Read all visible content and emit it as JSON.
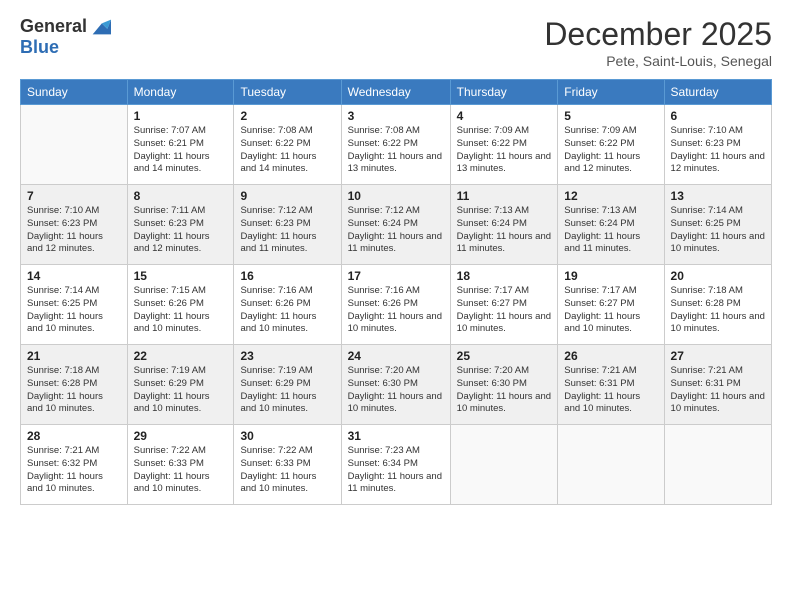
{
  "header": {
    "logo_general": "General",
    "logo_blue": "Blue",
    "month_title": "December 2025",
    "location": "Pete, Saint-Louis, Senegal"
  },
  "weekdays": [
    "Sunday",
    "Monday",
    "Tuesday",
    "Wednesday",
    "Thursday",
    "Friday",
    "Saturday"
  ],
  "weeks": [
    [
      {
        "day": "",
        "sunrise": "",
        "sunset": "",
        "daylight": ""
      },
      {
        "day": "1",
        "sunrise": "Sunrise: 7:07 AM",
        "sunset": "Sunset: 6:21 PM",
        "daylight": "Daylight: 11 hours and 14 minutes."
      },
      {
        "day": "2",
        "sunrise": "Sunrise: 7:08 AM",
        "sunset": "Sunset: 6:22 PM",
        "daylight": "Daylight: 11 hours and 14 minutes."
      },
      {
        "day": "3",
        "sunrise": "Sunrise: 7:08 AM",
        "sunset": "Sunset: 6:22 PM",
        "daylight": "Daylight: 11 hours and 13 minutes."
      },
      {
        "day": "4",
        "sunrise": "Sunrise: 7:09 AM",
        "sunset": "Sunset: 6:22 PM",
        "daylight": "Daylight: 11 hours and 13 minutes."
      },
      {
        "day": "5",
        "sunrise": "Sunrise: 7:09 AM",
        "sunset": "Sunset: 6:22 PM",
        "daylight": "Daylight: 11 hours and 12 minutes."
      },
      {
        "day": "6",
        "sunrise": "Sunrise: 7:10 AM",
        "sunset": "Sunset: 6:23 PM",
        "daylight": "Daylight: 11 hours and 12 minutes."
      }
    ],
    [
      {
        "day": "7",
        "sunrise": "Sunrise: 7:10 AM",
        "sunset": "Sunset: 6:23 PM",
        "daylight": "Daylight: 11 hours and 12 minutes."
      },
      {
        "day": "8",
        "sunrise": "Sunrise: 7:11 AM",
        "sunset": "Sunset: 6:23 PM",
        "daylight": "Daylight: 11 hours and 12 minutes."
      },
      {
        "day": "9",
        "sunrise": "Sunrise: 7:12 AM",
        "sunset": "Sunset: 6:23 PM",
        "daylight": "Daylight: 11 hours and 11 minutes."
      },
      {
        "day": "10",
        "sunrise": "Sunrise: 7:12 AM",
        "sunset": "Sunset: 6:24 PM",
        "daylight": "Daylight: 11 hours and 11 minutes."
      },
      {
        "day": "11",
        "sunrise": "Sunrise: 7:13 AM",
        "sunset": "Sunset: 6:24 PM",
        "daylight": "Daylight: 11 hours and 11 minutes."
      },
      {
        "day": "12",
        "sunrise": "Sunrise: 7:13 AM",
        "sunset": "Sunset: 6:24 PM",
        "daylight": "Daylight: 11 hours and 11 minutes."
      },
      {
        "day": "13",
        "sunrise": "Sunrise: 7:14 AM",
        "sunset": "Sunset: 6:25 PM",
        "daylight": "Daylight: 11 hours and 10 minutes."
      }
    ],
    [
      {
        "day": "14",
        "sunrise": "Sunrise: 7:14 AM",
        "sunset": "Sunset: 6:25 PM",
        "daylight": "Daylight: 11 hours and 10 minutes."
      },
      {
        "day": "15",
        "sunrise": "Sunrise: 7:15 AM",
        "sunset": "Sunset: 6:26 PM",
        "daylight": "Daylight: 11 hours and 10 minutes."
      },
      {
        "day": "16",
        "sunrise": "Sunrise: 7:16 AM",
        "sunset": "Sunset: 6:26 PM",
        "daylight": "Daylight: 11 hours and 10 minutes."
      },
      {
        "day": "17",
        "sunrise": "Sunrise: 7:16 AM",
        "sunset": "Sunset: 6:26 PM",
        "daylight": "Daylight: 11 hours and 10 minutes."
      },
      {
        "day": "18",
        "sunrise": "Sunrise: 7:17 AM",
        "sunset": "Sunset: 6:27 PM",
        "daylight": "Daylight: 11 hours and 10 minutes."
      },
      {
        "day": "19",
        "sunrise": "Sunrise: 7:17 AM",
        "sunset": "Sunset: 6:27 PM",
        "daylight": "Daylight: 11 hours and 10 minutes."
      },
      {
        "day": "20",
        "sunrise": "Sunrise: 7:18 AM",
        "sunset": "Sunset: 6:28 PM",
        "daylight": "Daylight: 11 hours and 10 minutes."
      }
    ],
    [
      {
        "day": "21",
        "sunrise": "Sunrise: 7:18 AM",
        "sunset": "Sunset: 6:28 PM",
        "daylight": "Daylight: 11 hours and 10 minutes."
      },
      {
        "day": "22",
        "sunrise": "Sunrise: 7:19 AM",
        "sunset": "Sunset: 6:29 PM",
        "daylight": "Daylight: 11 hours and 10 minutes."
      },
      {
        "day": "23",
        "sunrise": "Sunrise: 7:19 AM",
        "sunset": "Sunset: 6:29 PM",
        "daylight": "Daylight: 11 hours and 10 minutes."
      },
      {
        "day": "24",
        "sunrise": "Sunrise: 7:20 AM",
        "sunset": "Sunset: 6:30 PM",
        "daylight": "Daylight: 11 hours and 10 minutes."
      },
      {
        "day": "25",
        "sunrise": "Sunrise: 7:20 AM",
        "sunset": "Sunset: 6:30 PM",
        "daylight": "Daylight: 11 hours and 10 minutes."
      },
      {
        "day": "26",
        "sunrise": "Sunrise: 7:21 AM",
        "sunset": "Sunset: 6:31 PM",
        "daylight": "Daylight: 11 hours and 10 minutes."
      },
      {
        "day": "27",
        "sunrise": "Sunrise: 7:21 AM",
        "sunset": "Sunset: 6:31 PM",
        "daylight": "Daylight: 11 hours and 10 minutes."
      }
    ],
    [
      {
        "day": "28",
        "sunrise": "Sunrise: 7:21 AM",
        "sunset": "Sunset: 6:32 PM",
        "daylight": "Daylight: 11 hours and 10 minutes."
      },
      {
        "day": "29",
        "sunrise": "Sunrise: 7:22 AM",
        "sunset": "Sunset: 6:33 PM",
        "daylight": "Daylight: 11 hours and 10 minutes."
      },
      {
        "day": "30",
        "sunrise": "Sunrise: 7:22 AM",
        "sunset": "Sunset: 6:33 PM",
        "daylight": "Daylight: 11 hours and 10 minutes."
      },
      {
        "day": "31",
        "sunrise": "Sunrise: 7:23 AM",
        "sunset": "Sunset: 6:34 PM",
        "daylight": "Daylight: 11 hours and 11 minutes."
      },
      {
        "day": "",
        "sunrise": "",
        "sunset": "",
        "daylight": ""
      },
      {
        "day": "",
        "sunrise": "",
        "sunset": "",
        "daylight": ""
      },
      {
        "day": "",
        "sunrise": "",
        "sunset": "",
        "daylight": ""
      }
    ]
  ]
}
